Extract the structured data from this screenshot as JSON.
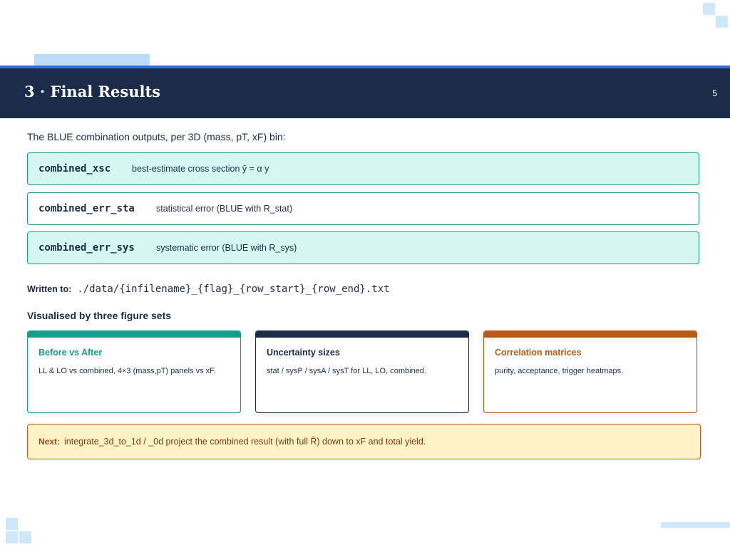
{
  "header": {
    "title": "3 · Final Results",
    "page_number": "5"
  },
  "intro": "The BLUE combination outputs, per 3D (mass, pT, xF) bin:",
  "outputs": [
    {
      "name": "combined_xsc",
      "description": "best-estimate cross section ŷ = α y"
    },
    {
      "name": "combined_err_sta",
      "description": "statistical error  (BLUE with R_stat)"
    },
    {
      "name": "combined_err_sys",
      "description": "systematic error  (BLUE with R_sys)"
    }
  ],
  "written": {
    "label": "Written to:",
    "path": "./data/{infilename}_{flag}_{row_start}_{row_end}.txt"
  },
  "visualised_heading": "Visualised by three figure sets",
  "cards": [
    {
      "title": "Before vs After",
      "text": "LL & LO vs combined, 4×3 (mass,pT) panels vs xF.",
      "color": "#139e8b"
    },
    {
      "title": "Uncertainty sizes",
      "text": "stat / sysP / sysA / sysT for LL, LO, combined.",
      "color": "#1c2b4a"
    },
    {
      "title": "Correlation matrices",
      "text": "purity, acceptance, trigger heatmaps.",
      "color": "#b65a16"
    }
  ],
  "next": {
    "label": "Next:",
    "text": "integrate_3d_to_1d / _0d project the combined result (with full R̂) down to xF and total yield."
  }
}
